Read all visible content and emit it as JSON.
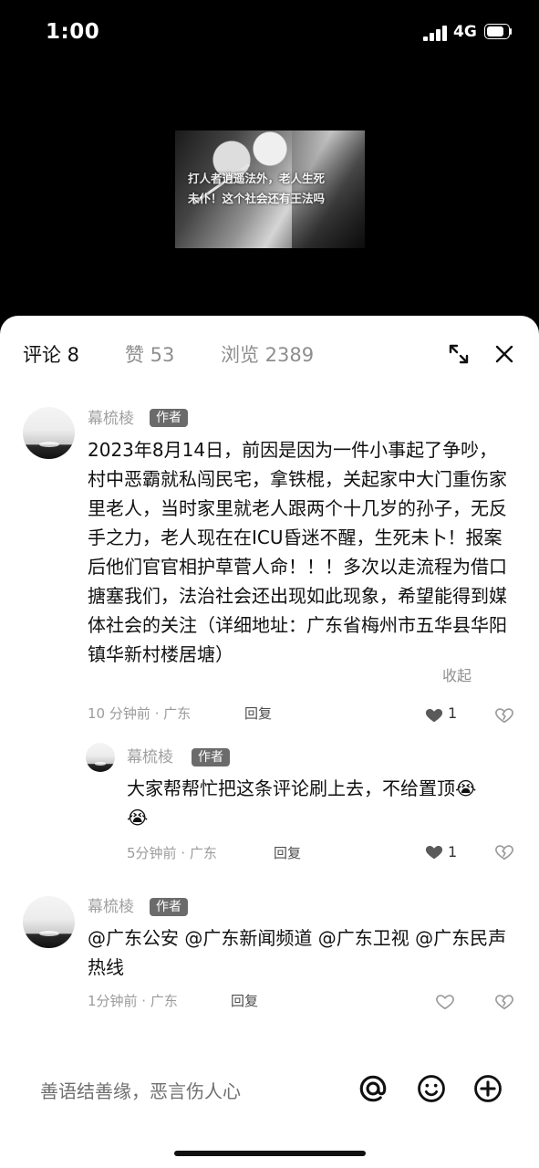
{
  "status_bar": {
    "time": "1:00",
    "network": "4G"
  },
  "video": {
    "caption_line_1": "打人者逍遥法外，老人生死",
    "caption_line_2": "未仆！这个社会还有王法吗"
  },
  "tabs": [
    {
      "label": "评论 8",
      "active": true
    },
    {
      "label": "赞 53",
      "active": false
    },
    {
      "label": "浏览 2389",
      "active": false
    }
  ],
  "comments": [
    {
      "username": "幕梳棱",
      "badge": "作者",
      "text": "2023年8月14日，前因是因为一件小事起了争吵，村中恶霸就私闯民宅，拿铁棍，关起家中大门重伤家里老人，当时家里就老人跟两个十几岁的孙子，无反手之力，老人现在在ICU昏迷不醒，生死未卜！报案后他们官官相护草菅人命！！！多次以走流程为借口搪塞我们，法治社会还出现如此现象，希望能得到媒体社会的关注（详细地址：广东省梅州市五华县华阳镇华新村楼居塘）",
      "collapse": "收起",
      "meta": "10 分钟前 · 广东",
      "reply": "回复",
      "likes": "1"
    },
    {
      "username": "幕梳棱",
      "badge": "作者",
      "text": "大家帮帮忙把这条评论刷上去，不给置顶😭😭",
      "meta": "5分钟前 · 广东",
      "reply": "回复",
      "likes": "1"
    },
    {
      "username": "幕梳棱",
      "badge": "作者",
      "text": "@广东公安 @广东新闻频道 @广东卫视 @广东民声热线",
      "meta": "1分钟前 · 广东",
      "reply": "回复"
    }
  ],
  "input": {
    "placeholder": "善语结善缘，恶言伤人心"
  },
  "icons": {
    "expand": "expand-icon",
    "close": "close-icon",
    "like": "heart-icon",
    "dislike": "broken-heart-icon",
    "mention": "at-icon",
    "emoji": "emoji-icon",
    "add": "plus-icon"
  }
}
